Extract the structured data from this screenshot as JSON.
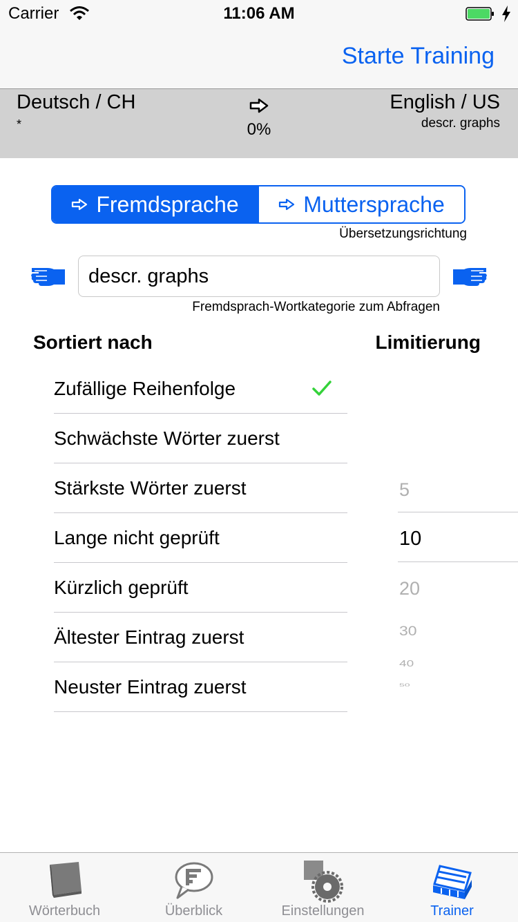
{
  "status_bar": {
    "carrier": "Carrier",
    "time": "11:06 AM"
  },
  "nav": {
    "action": "Starte Training"
  },
  "info": {
    "source_language": "Deutsch / CH",
    "source_category": "*",
    "target_language": "English / US",
    "target_category": "descr. graphs",
    "progress": "0%"
  },
  "direction": {
    "options": [
      "Fremdsprache",
      "Muttersprache"
    ],
    "selected": "Fremdsprache",
    "caption": "Übersetzungsrichtung"
  },
  "category": {
    "value": "descr. graphs",
    "caption": "Fremdsprach-Wortkategorie zum Abfragen"
  },
  "sort": {
    "heading": "Sortiert nach",
    "options": [
      "Zufällige Reihenfolge",
      "Schwächste Wörter zuerst",
      "Stärkste Wörter zuerst",
      "Lange nicht geprüft",
      "Kürzlich geprüft",
      "Ältester Eintrag zuerst",
      "Neuster Eintrag zuerst"
    ],
    "selected": "Zufällige Reihenfolge"
  },
  "limit": {
    "heading": "Limitierung",
    "above": "5",
    "selected": "10",
    "below": [
      "20",
      "30",
      "40",
      "50"
    ]
  },
  "tabs": [
    {
      "label": "Wörterbuch",
      "icon": "book-icon"
    },
    {
      "label": "Überblick",
      "icon": "speech-bubble-list-icon"
    },
    {
      "label": "Einstellungen",
      "icon": "gears-icon"
    },
    {
      "label": "Trainer",
      "icon": "card-box-icon"
    }
  ],
  "active_tab": "Trainer",
  "colors": {
    "accent": "#0a62f0",
    "check": "#34d23a",
    "band": "#d1d1d1",
    "bar": "#f7f7f7"
  }
}
